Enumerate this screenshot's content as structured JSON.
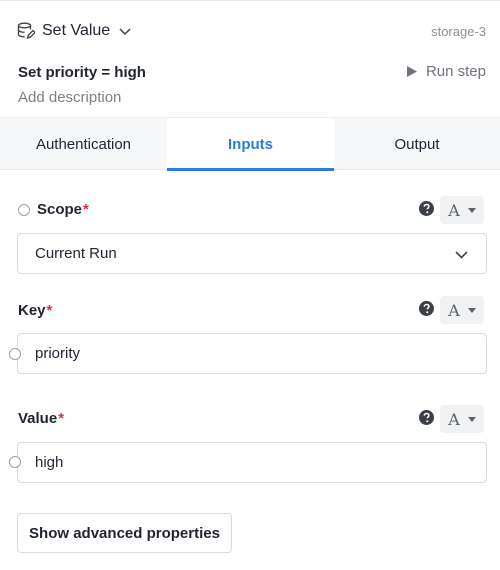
{
  "header": {
    "step_type": "Set Value",
    "step_id": "storage-3",
    "step_name": "Set priority = high",
    "run_step_label": "Run step",
    "description_placeholder": "Add description",
    "step_icon": "database-edit-icon"
  },
  "tabs": [
    {
      "label": "Authentication",
      "active": false
    },
    {
      "label": "Inputs",
      "active": true
    },
    {
      "label": "Output",
      "active": false
    }
  ],
  "accent_color": "#2c7be5",
  "required_color": "#e5283d",
  "fields": {
    "scope": {
      "label": "Scope",
      "required_mark": "*",
      "type_toggle": "A",
      "value": "Current Run"
    },
    "key": {
      "label": "Key",
      "required_mark": "*",
      "type_toggle": "A",
      "value": "priority"
    },
    "value": {
      "label": "Value",
      "required_mark": "*",
      "type_toggle": "A",
      "value": "high"
    }
  },
  "advanced_button_label": "Show advanced properties"
}
